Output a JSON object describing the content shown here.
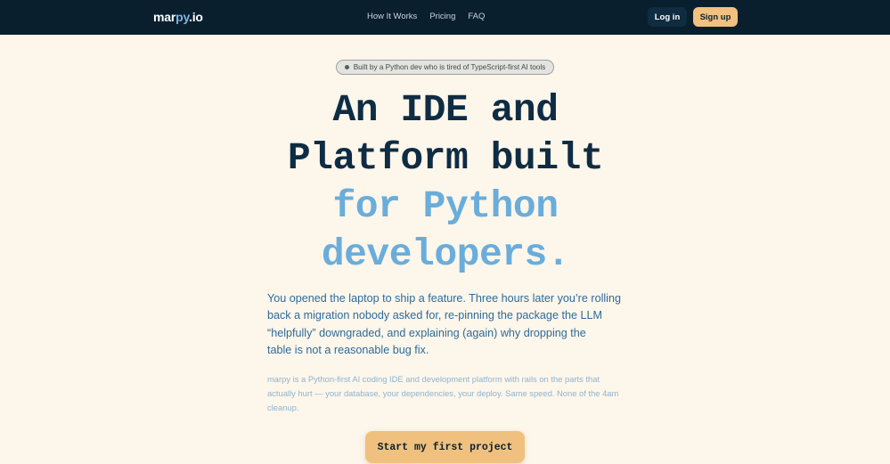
{
  "nav": {
    "logo_prefix": "mar",
    "logo_accent": "py",
    "logo_suffix": ".io",
    "links": [
      "How It Works",
      "Pricing",
      "FAQ"
    ],
    "login_label": "Log in",
    "signup_label": "Sign up"
  },
  "hero": {
    "badge": "Built by a Python dev who is tired of TypeScript-first AI tools",
    "headline_dark_1": "An IDE and",
    "headline_dark_2": "Platform built",
    "headline_light_1": "for Python",
    "headline_light_2": "developers.",
    "lead_part1": "You opened the laptop to ship a feature. Three hours later you’re rolling back a migration nobody asked for, re-pinning the package the LLM “helpfully” downgraded, and explaining (again) why dropping the",
    "lead_part2": "table is not a reasonable bug fix.",
    "sub": "marpy is a Python-first AI coding IDE and development platform with rails on the parts that actually hurt — your database, your dependencies, your deploy. Same speed. None of the 4am cleanup.",
    "cta_label": "Start my first project"
  },
  "colors": {
    "nav_bg": "#0a1f2e",
    "page_bg": "#fdf6ea",
    "accent_amber": "#f2c17f",
    "headline_dark": "#0e2c44",
    "headline_light": "#6aaddb"
  }
}
